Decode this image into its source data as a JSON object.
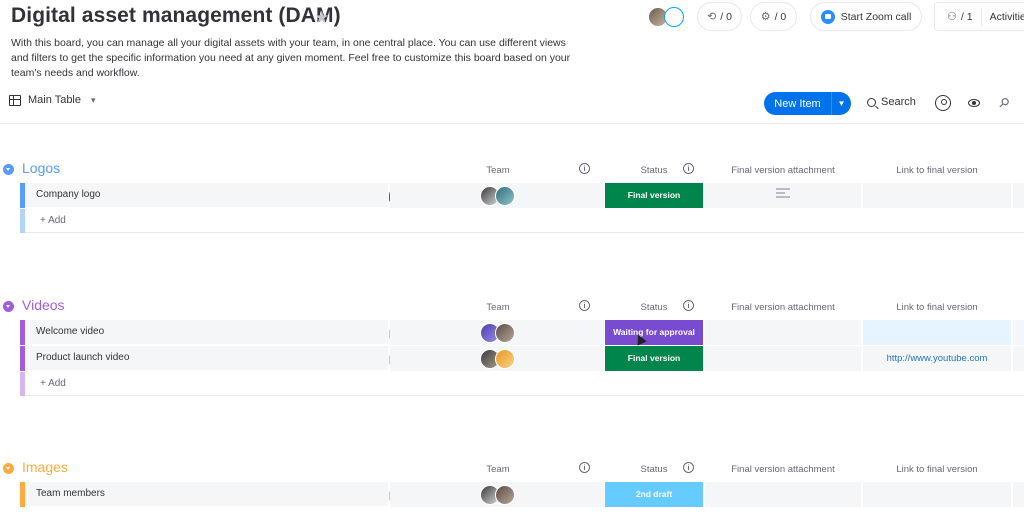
{
  "header": {
    "title": "Digital asset management (DAM)",
    "description": "With this board, you can manage all your digital assets with your team, in one central place. You can use different views and filters to get the specific information you need at any given moment. Feel free to customize this board based on your team's needs and workflow.",
    "integrations_count": "/ 0",
    "automations_count": "/ 0",
    "zoom_label": "Start Zoom call",
    "members_count": "/ 1",
    "activity_label": "Activitie"
  },
  "toolbar": {
    "view_label": "Main Table",
    "new_item_label": "New Item",
    "search_label": "Search"
  },
  "columns": {
    "team": "Team",
    "status": "Status",
    "attachment": "Final version attachment",
    "link": "Link to final version"
  },
  "add_label": "+ Add",
  "colors": {
    "logos": "#579bfc",
    "videos": "#a25ddc",
    "images": "#fdab3d",
    "final_version": "#00854d",
    "waiting": "#784bd1",
    "draft": "#66ccff"
  },
  "groups": [
    {
      "title": "Logos",
      "rows": [
        {
          "name": "Company logo",
          "status": "Final version",
          "comments": "1",
          "link": ""
        }
      ]
    },
    {
      "title": "Videos",
      "rows": [
        {
          "name": "Welcome video",
          "status": "Waiting for approval",
          "link": ""
        },
        {
          "name": "Product launch video",
          "status": "Final version",
          "link": "http://www.youtube.com"
        }
      ]
    },
    {
      "title": "Images",
      "rows": [
        {
          "name": "Team members",
          "status": "2nd draft",
          "link": ""
        }
      ]
    }
  ]
}
